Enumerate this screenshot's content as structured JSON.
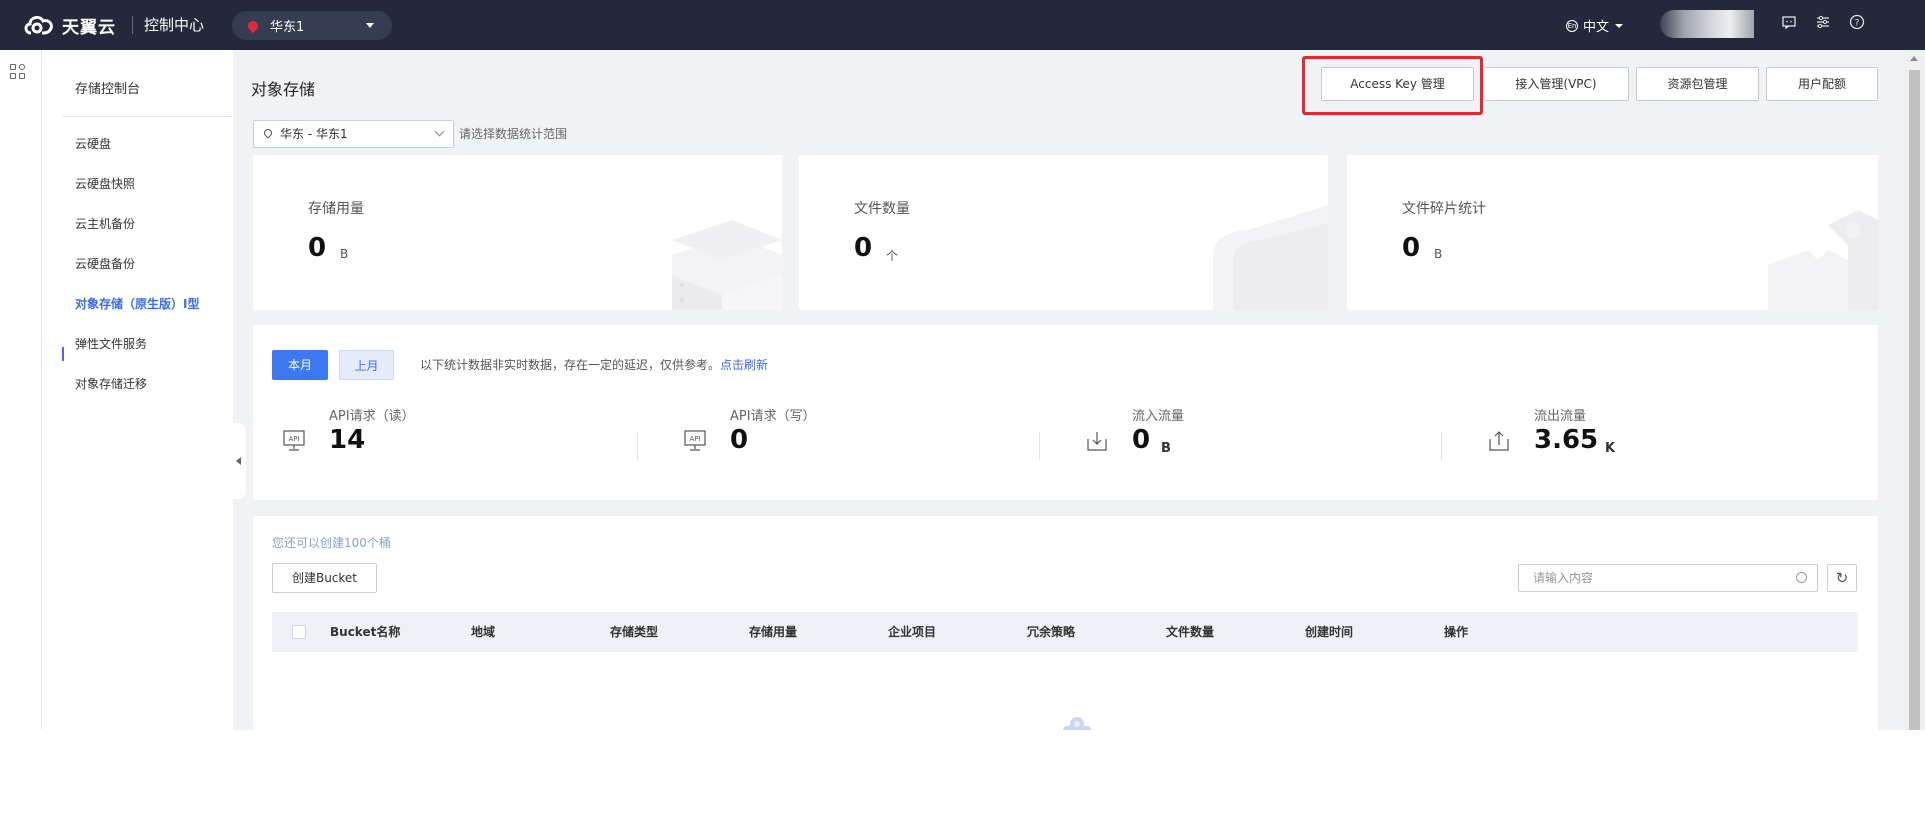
{
  "topbar": {
    "logo_text": "天翼云",
    "console_label": "控制中心",
    "region": "华东1",
    "language": "中文"
  },
  "sidebar": {
    "title": "存储控制台",
    "items": [
      {
        "label": "云硬盘"
      },
      {
        "label": "云硬盘快照"
      },
      {
        "label": "云主机备份"
      },
      {
        "label": "云硬盘备份"
      },
      {
        "label": "对象存储（原生版）Ⅰ型",
        "active": true
      },
      {
        "label": "弹性文件服务"
      },
      {
        "label": "对象存储迁移"
      }
    ]
  },
  "main": {
    "title": "对象存储",
    "buttons": {
      "access_key": "Access Key 管理",
      "vpc": "接入管理(VPC)",
      "package": "资源包管理",
      "quota": "用户配额"
    },
    "scope_select": "华东 - 华东1",
    "scope_hint": "请选择数据统计范围",
    "cards": [
      {
        "label": "存储用量",
        "value": "0",
        "unit": "B"
      },
      {
        "label": "文件数量",
        "value": "0",
        "unit": "个"
      },
      {
        "label": "文件碎片统计",
        "value": "0",
        "unit": "B"
      }
    ],
    "stats_tabs": {
      "current": "本月",
      "last": "上月"
    },
    "stats_note": "以下统计数据非实时数据，存在一定的延迟，仅供参考。",
    "stats_refresh": "点击刷新",
    "stats": [
      {
        "label": "API请求（读）",
        "value": "14",
        "unit": "",
        "icon": "api-icon"
      },
      {
        "label": "API请求（写）",
        "value": "0",
        "unit": "",
        "icon": "api-icon"
      },
      {
        "label": "流入流量",
        "value": "0",
        "unit": "B",
        "icon": "download-icon"
      },
      {
        "label": "流出流量",
        "value": "3.65",
        "unit": "K",
        "icon": "upload-icon"
      }
    ],
    "bucket_quota_hint": "您还可以创建100个桶",
    "create_bucket": "创建Bucket",
    "search_placeholder": "请输入内容",
    "table_headers": [
      "Bucket名称",
      "地域",
      "存储类型",
      "存储用量",
      "企业项目",
      "冗余策略",
      "文件数量",
      "创建时间",
      "操作"
    ]
  },
  "colors": {
    "topbar": "#23293b",
    "accent": "#3c6cf0",
    "highlight": "#e5282d",
    "page_bg": "#f1f2f6"
  }
}
